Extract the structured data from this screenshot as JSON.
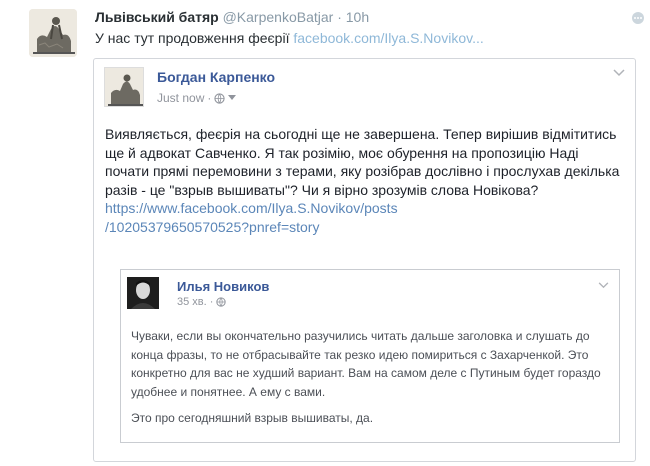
{
  "tweet": {
    "author_name": "Львівський батяр",
    "handle": "@KarpenkoBatjar",
    "separator": "·",
    "time": "10h",
    "text": "У нас тут продовження феєрії",
    "link": "facebook.com/Ilya.S.Novikov...",
    "avatar_icon": "vintage-illustration-avatar",
    "more_icon": "dots-icon"
  },
  "fb_post": {
    "author": "Богдан Карпенко",
    "time": "Just now",
    "separator": "·",
    "privacy_icon": "globe-icon",
    "menu_icon": "chevron-down-icon",
    "body": "Виявляється, феєрія на сьогодні ще не завершена. Тепер вирішив відмітитись ще й адвокат Савченко. Я так розімію, моє обурення на пропозицію Наді почати прямі перемовини з терами, яку розібрав дослівно і прослухав декілька разів - це \"взрыв вышиваты\"? Чи я вірно зрозумів слова Новікова?",
    "link_line1": "https://www.facebook.com/Ilya.S.Novikov/posts",
    "link_line2": "/10205379650570525?pnref=story"
  },
  "quoted_post": {
    "author": "Илья Новиков",
    "time": "35 хв.",
    "separator": "·",
    "privacy_icon": "globe-icon",
    "menu_icon": "chevron-down-icon",
    "paragraph1": "Чуваки, если вы окончательно разучились читать дальше заголовка и слушать до конца фразы, то не отбрасывайте так резко идею помириться с Захарченкой. Это конкретно для вас не худший вариант. Вам на самом деле с Путиным будет гораздо удобнее и понятнее. А ему с вами.",
    "paragraph2": "Это про сегодняшний взрыв вышиваты, да."
  }
}
